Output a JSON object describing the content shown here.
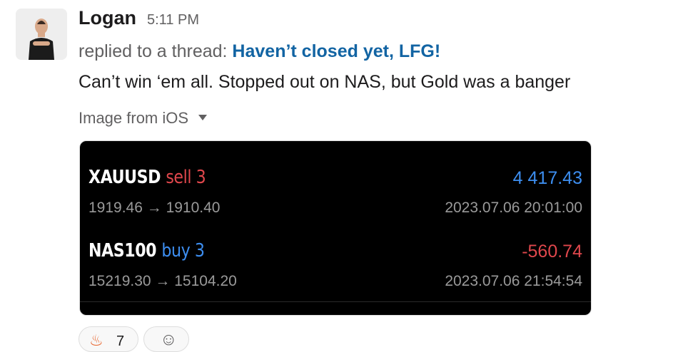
{
  "message": {
    "author": "Logan",
    "time": "5:11 PM",
    "thread_prefix": "replied to a thread: ",
    "thread_title": "Haven’t closed yet, LFG!",
    "text": "Can’t win ‘em all. Stopped out on NAS, but Gold was a banger",
    "attachment_label": "Image from iOS"
  },
  "trades": [
    {
      "symbol": "XAUUSD",
      "side": "sell 3",
      "side_color": "#e0474c",
      "pnl": "4 417.43",
      "pnl_color": "#3d8ef0",
      "prices": "1919.46 → 1910.40",
      "timestamp": "2023.07.06 20:01:00"
    },
    {
      "symbol": "NAS100",
      "side": "buy 3",
      "side_color": "#3d8ef0",
      "pnl": "-560.74",
      "pnl_color": "#e0474c",
      "prices": "15219.30 → 15104.20",
      "timestamp": "2023.07.06 21:54:54"
    }
  ],
  "reactions": [
    {
      "icon": "fire-icon",
      "count": "7"
    },
    {
      "icon": "add-reaction-icon"
    }
  ]
}
